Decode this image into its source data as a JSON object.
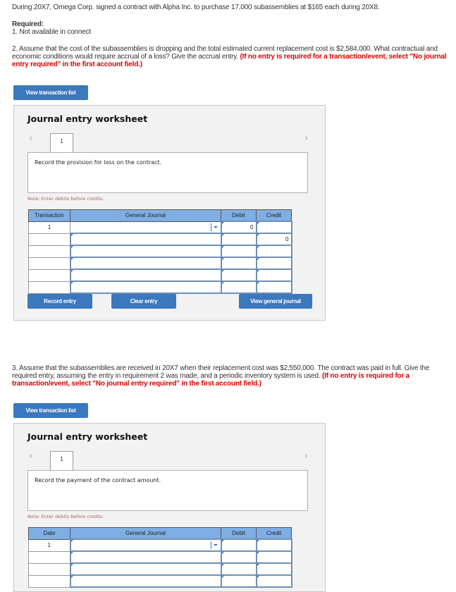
{
  "intro": "During 20X7, Omega Corp. signed a contract with Alpha Inc. to purchase 17,000 subassemblies at $165 each during 20X8.",
  "required_label": "Required:",
  "req1": "1. Not available in connect",
  "req2": {
    "text": "2. Assume that the cost of the subassemblies is dropping and the total estimated current replacement cost is $2,584,000. What contractual and economic conditions would require accrual of a loss? Give the accrual entry.",
    "instruction": "(If no entry is required for a transaction/event, select \"No journal entry required\" in the first account field.)"
  },
  "req3": {
    "text": "3. Assume that the subassemblies are received in 20X7 when their replacement cost was $2,550,000. The contract was paid in full. Give the required entry, assuming the entry in requirement 2 was made, and a periodic inventory system is used.",
    "instruction": "(If no entry is required for a transaction/event, select \"No journal entry required\" in the first account field.)"
  },
  "worksheet1": {
    "view_button": "View transaction list",
    "title": "Journal entry worksheet",
    "tab": "1",
    "description": "Record the provision for loss on the contract.",
    "note": "Note: Enter debits before credits.",
    "columns": [
      "Transaction",
      "General Journal",
      "Debit",
      "Credit"
    ],
    "rows": [
      {
        "id": "1",
        "account": "",
        "debit": "0",
        "credit": ""
      },
      {
        "id": "",
        "account": "",
        "debit": "",
        "credit": "0"
      },
      {
        "id": "",
        "account": "",
        "debit": "",
        "credit": ""
      },
      {
        "id": "",
        "account": "",
        "debit": "",
        "credit": ""
      },
      {
        "id": "",
        "account": "",
        "debit": "",
        "credit": ""
      },
      {
        "id": "",
        "account": "",
        "debit": "",
        "credit": ""
      }
    ],
    "record_button": "Record entry",
    "clear_button": "Clear entry",
    "view_journal_button": "View general journal"
  },
  "worksheet2": {
    "view_button": "View transaction list",
    "title": "Journal entry worksheet",
    "tab": "1",
    "description": "Record the payment of the contract amount.",
    "note": "Note: Enter debits before credits.",
    "columns": [
      "Date",
      "General Journal",
      "Debit",
      "Credit"
    ],
    "rows": [
      {
        "id": "1",
        "account": "",
        "debit": "",
        "credit": ""
      },
      {
        "id": "",
        "account": "",
        "debit": "",
        "credit": ""
      },
      {
        "id": "",
        "account": "",
        "debit": "",
        "credit": ""
      },
      {
        "id": "",
        "account": "",
        "debit": "",
        "credit": ""
      }
    ]
  },
  "icons": {
    "prev": "chevron-left-icon",
    "next": "chevron-right-icon",
    "dropdown": "caret-down-icon"
  }
}
